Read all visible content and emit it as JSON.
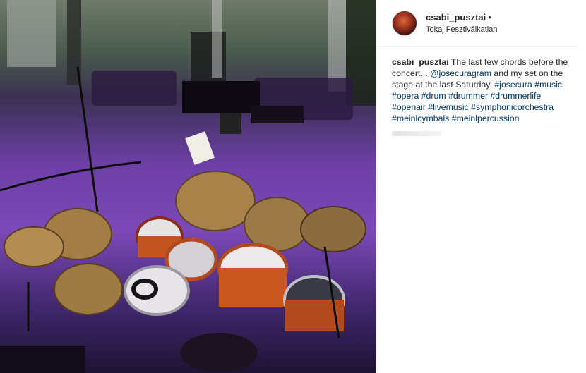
{
  "post": {
    "username": "csabi_pusztai",
    "header_dot": "•",
    "location": "Tokaj Fesztiválkatlan",
    "caption": {
      "author": "csabi_pusztai",
      "text_1": " The last few chords before the concert... ",
      "mention": "@josecuragram",
      "text_2": " and my set on the stage at the last Saturday. ",
      "hashtags": [
        "#josecura",
        "#music",
        "#opera",
        "#drum",
        "#drummer",
        "#drummerlife",
        "#openair",
        "#livemusic",
        "#symphonicorchestra",
        "#meinlcymbals",
        "#meinlpercussion"
      ]
    }
  },
  "photo": {
    "description_icon": "drum-kit-photo",
    "colors": {
      "stage": "#7b49b8",
      "cymbal": "#b08a4a",
      "drum_shell": "#c5521e"
    }
  }
}
